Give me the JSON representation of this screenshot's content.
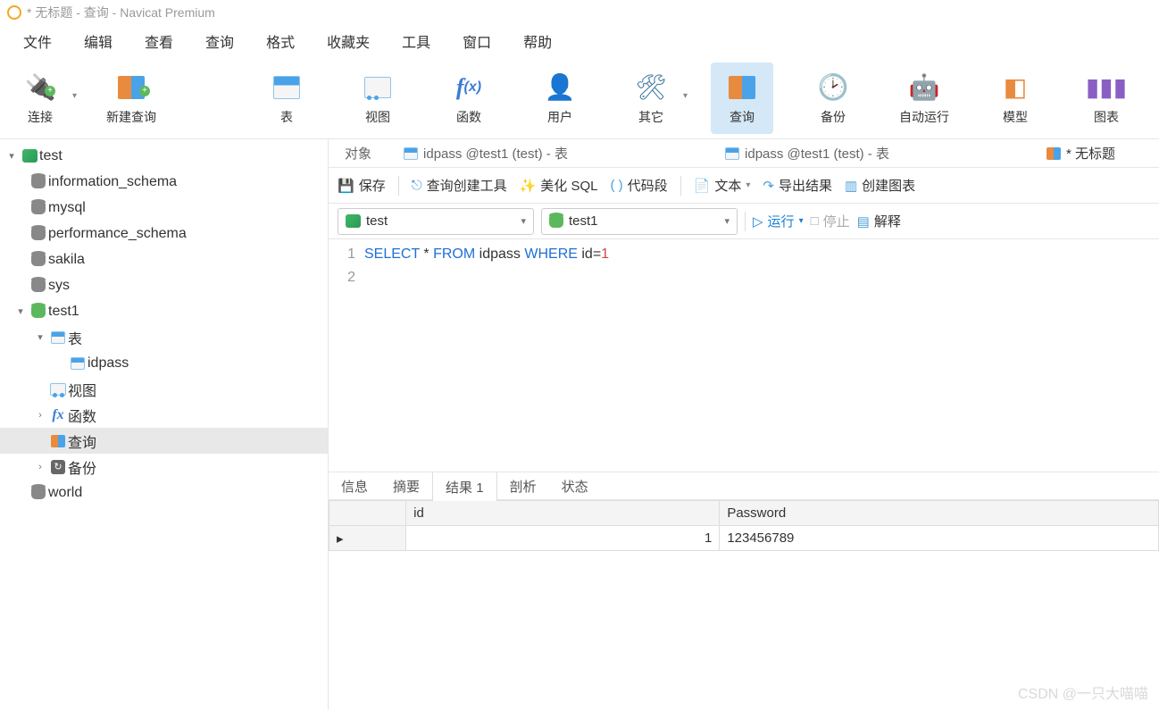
{
  "title": "* 无标题 - 查询 - Navicat Premium",
  "menu": [
    "文件",
    "编辑",
    "查看",
    "查询",
    "格式",
    "收藏夹",
    "工具",
    "窗口",
    "帮助"
  ],
  "ribbon": [
    {
      "label": "连接",
      "dd": true
    },
    {
      "label": "新建查询"
    },
    {
      "label": "表"
    },
    {
      "label": "视图"
    },
    {
      "label": "函数"
    },
    {
      "label": "用户"
    },
    {
      "label": "其它",
      "dd": true
    },
    {
      "label": "查询",
      "active": true
    },
    {
      "label": "备份"
    },
    {
      "label": "自动运行"
    },
    {
      "label": "模型"
    },
    {
      "label": "图表"
    }
  ],
  "tree": {
    "conn": "test",
    "dbs": [
      "information_schema",
      "mysql",
      "performance_schema",
      "sakila",
      "sys"
    ],
    "openDb": "test1",
    "openDbChildren": {
      "tables": "表",
      "tableItems": [
        "idpass"
      ],
      "views": "视图",
      "functions": "函数",
      "queries": "查询",
      "backups": "备份"
    },
    "lastDb": "world"
  },
  "tabs": [
    {
      "label": "对象"
    },
    {
      "label": "idpass @test1 (test) - 表"
    },
    {
      "label": "idpass @test1 (test) - 表"
    },
    {
      "label": "* 无标题",
      "active": true
    }
  ],
  "toolbar": {
    "save": "保存",
    "builder": "查询创建工具",
    "beautify": "美化 SQL",
    "snippet": "代码段",
    "text": "文本",
    "export": "导出结果",
    "chart": "创建图表"
  },
  "selectors": {
    "conn": "test",
    "db": "test1",
    "run": "运行",
    "stop": "停止",
    "explain": "解释"
  },
  "sql": {
    "line1": {
      "k1": "SELECT",
      "star": "*",
      "k2": "FROM",
      "t": "idpass",
      "k3": "WHERE",
      "col": "id",
      "eq": "=",
      "val": "1"
    },
    "lines": [
      "1",
      "2"
    ]
  },
  "resultTabs": [
    "信息",
    "摘要",
    "结果 1",
    "剖析",
    "状态"
  ],
  "resultActive": "结果 1",
  "grid": {
    "headers": [
      "id",
      "Password"
    ],
    "rows": [
      {
        "id": "1",
        "pwd": "123456789"
      }
    ]
  },
  "watermark": "CSDN @一只大喵喵"
}
